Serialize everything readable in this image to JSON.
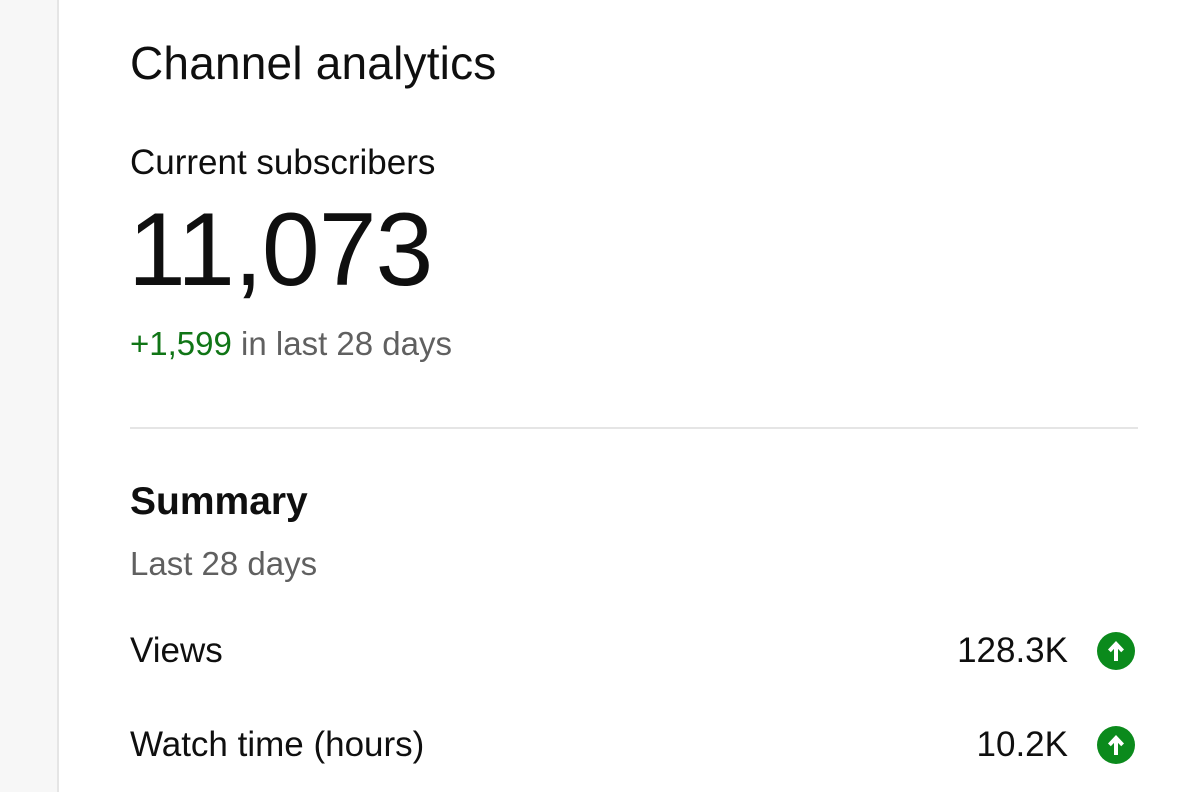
{
  "page": {
    "title": "Channel analytics"
  },
  "subscribers": {
    "label": "Current subscribers",
    "count": "11,073",
    "delta_value": "+1,599",
    "delta_suffix": " in last 28 days"
  },
  "summary": {
    "title": "Summary",
    "period": "Last 28 days",
    "metrics": [
      {
        "label": "Views",
        "value": "128.3K",
        "trend_icon": "arrow-up-circle-icon",
        "trend": "up"
      },
      {
        "label": "Watch time (hours)",
        "value": "10.2K",
        "trend_icon": "arrow-up-circle-icon",
        "trend": "up"
      }
    ]
  },
  "colors": {
    "positive": "#107516",
    "trend_icon_bg": "#0b8a1c",
    "secondary_text": "#606060",
    "primary_text": "#0f0f0f",
    "divider": "#e5e5e5"
  }
}
